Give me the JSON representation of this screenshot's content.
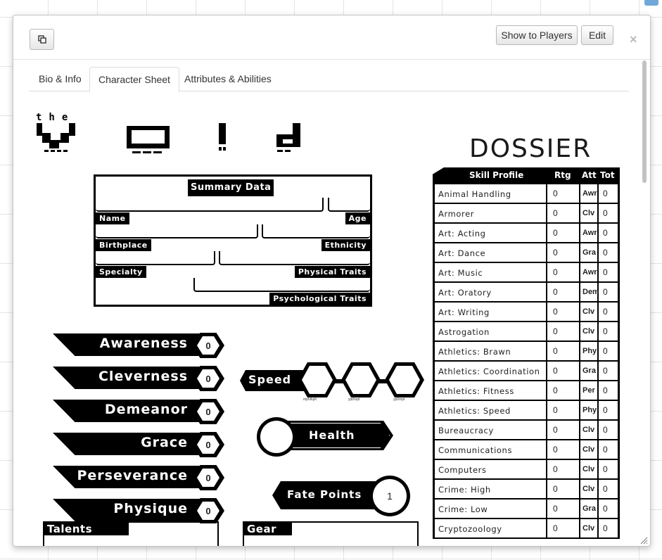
{
  "header": {
    "show_players_label": "Show to Players",
    "edit_label": "Edit",
    "close_label": "×"
  },
  "tabs": [
    {
      "label": "Bio & Info"
    },
    {
      "label": "Character Sheet"
    },
    {
      "label": "Attributes & Abilities"
    }
  ],
  "logo": {
    "title_letters": "the",
    "dossier": "DOSSIER"
  },
  "summary": {
    "title": "Summary Data",
    "labels": {
      "name": "Name",
      "age": "Age",
      "birthplace": "Birthplace",
      "ethnicity": "Ethnicity",
      "specialty": "Specialty",
      "physical": "Physical Traits",
      "psychological": "Psychological Traits"
    }
  },
  "attributes": [
    {
      "name": "Awareness",
      "value": "0"
    },
    {
      "name": "Cleverness",
      "value": "0"
    },
    {
      "name": "Demeanor",
      "value": "0"
    },
    {
      "name": "Grace",
      "value": "0"
    },
    {
      "name": "Perseverance",
      "value": "0"
    },
    {
      "name": "Physique",
      "value": "0"
    }
  ],
  "speed": {
    "label": "Speed",
    "sub": [
      "mph/kph",
      "ypt/mpt",
      "ypt/mpt"
    ]
  },
  "health": {
    "label": "Health"
  },
  "fate": {
    "label": "Fate Points",
    "value": "1"
  },
  "skills": {
    "headers": {
      "profile": "Skill Profile",
      "rtg": "Rtg",
      "att": "Att",
      "tot": "Tot"
    },
    "rows": [
      {
        "name": "Animal Handling",
        "rtg": "0",
        "att": "Awr",
        "tot": "0"
      },
      {
        "name": "Armorer",
        "rtg": "0",
        "att": "Clv",
        "tot": "0"
      },
      {
        "name": "Art: Acting",
        "rtg": "0",
        "att": "Awr",
        "tot": "0"
      },
      {
        "name": "Art: Dance",
        "rtg": "0",
        "att": "Gra",
        "tot": "0"
      },
      {
        "name": "Art: Music",
        "rtg": "0",
        "att": "Awr",
        "tot": "0"
      },
      {
        "name": "Art: Oratory",
        "rtg": "0",
        "att": "Dem",
        "tot": "0"
      },
      {
        "name": "Art: Writing",
        "rtg": "0",
        "att": "Clv",
        "tot": "0"
      },
      {
        "name": "Astrogation",
        "rtg": "0",
        "att": "Clv",
        "tot": "0"
      },
      {
        "name": "Athletics: Brawn",
        "rtg": "0",
        "att": "Phy",
        "tot": "0"
      },
      {
        "name": "Athletics: Coordination",
        "rtg": "0",
        "att": "Gra",
        "tot": "0"
      },
      {
        "name": "Athletics: Fitness",
        "rtg": "0",
        "att": "Per",
        "tot": "0"
      },
      {
        "name": "Athletics: Speed",
        "rtg": "0",
        "att": "Phy",
        "tot": "0"
      },
      {
        "name": "Bureaucracy",
        "rtg": "0",
        "att": "Clv",
        "tot": "0"
      },
      {
        "name": "Communications",
        "rtg": "0",
        "att": "Clv",
        "tot": "0"
      },
      {
        "name": "Computers",
        "rtg": "0",
        "att": "Clv",
        "tot": "0"
      },
      {
        "name": "Crime: High",
        "rtg": "0",
        "att": "Clv",
        "tot": "0"
      },
      {
        "name": "Crime: Low",
        "rtg": "0",
        "att": "Gra",
        "tot": "0"
      },
      {
        "name": "Cryptozoology",
        "rtg": "0",
        "att": "Clv",
        "tot": "0"
      }
    ]
  },
  "sections": {
    "talents": "Talents",
    "gear": "Gear"
  }
}
